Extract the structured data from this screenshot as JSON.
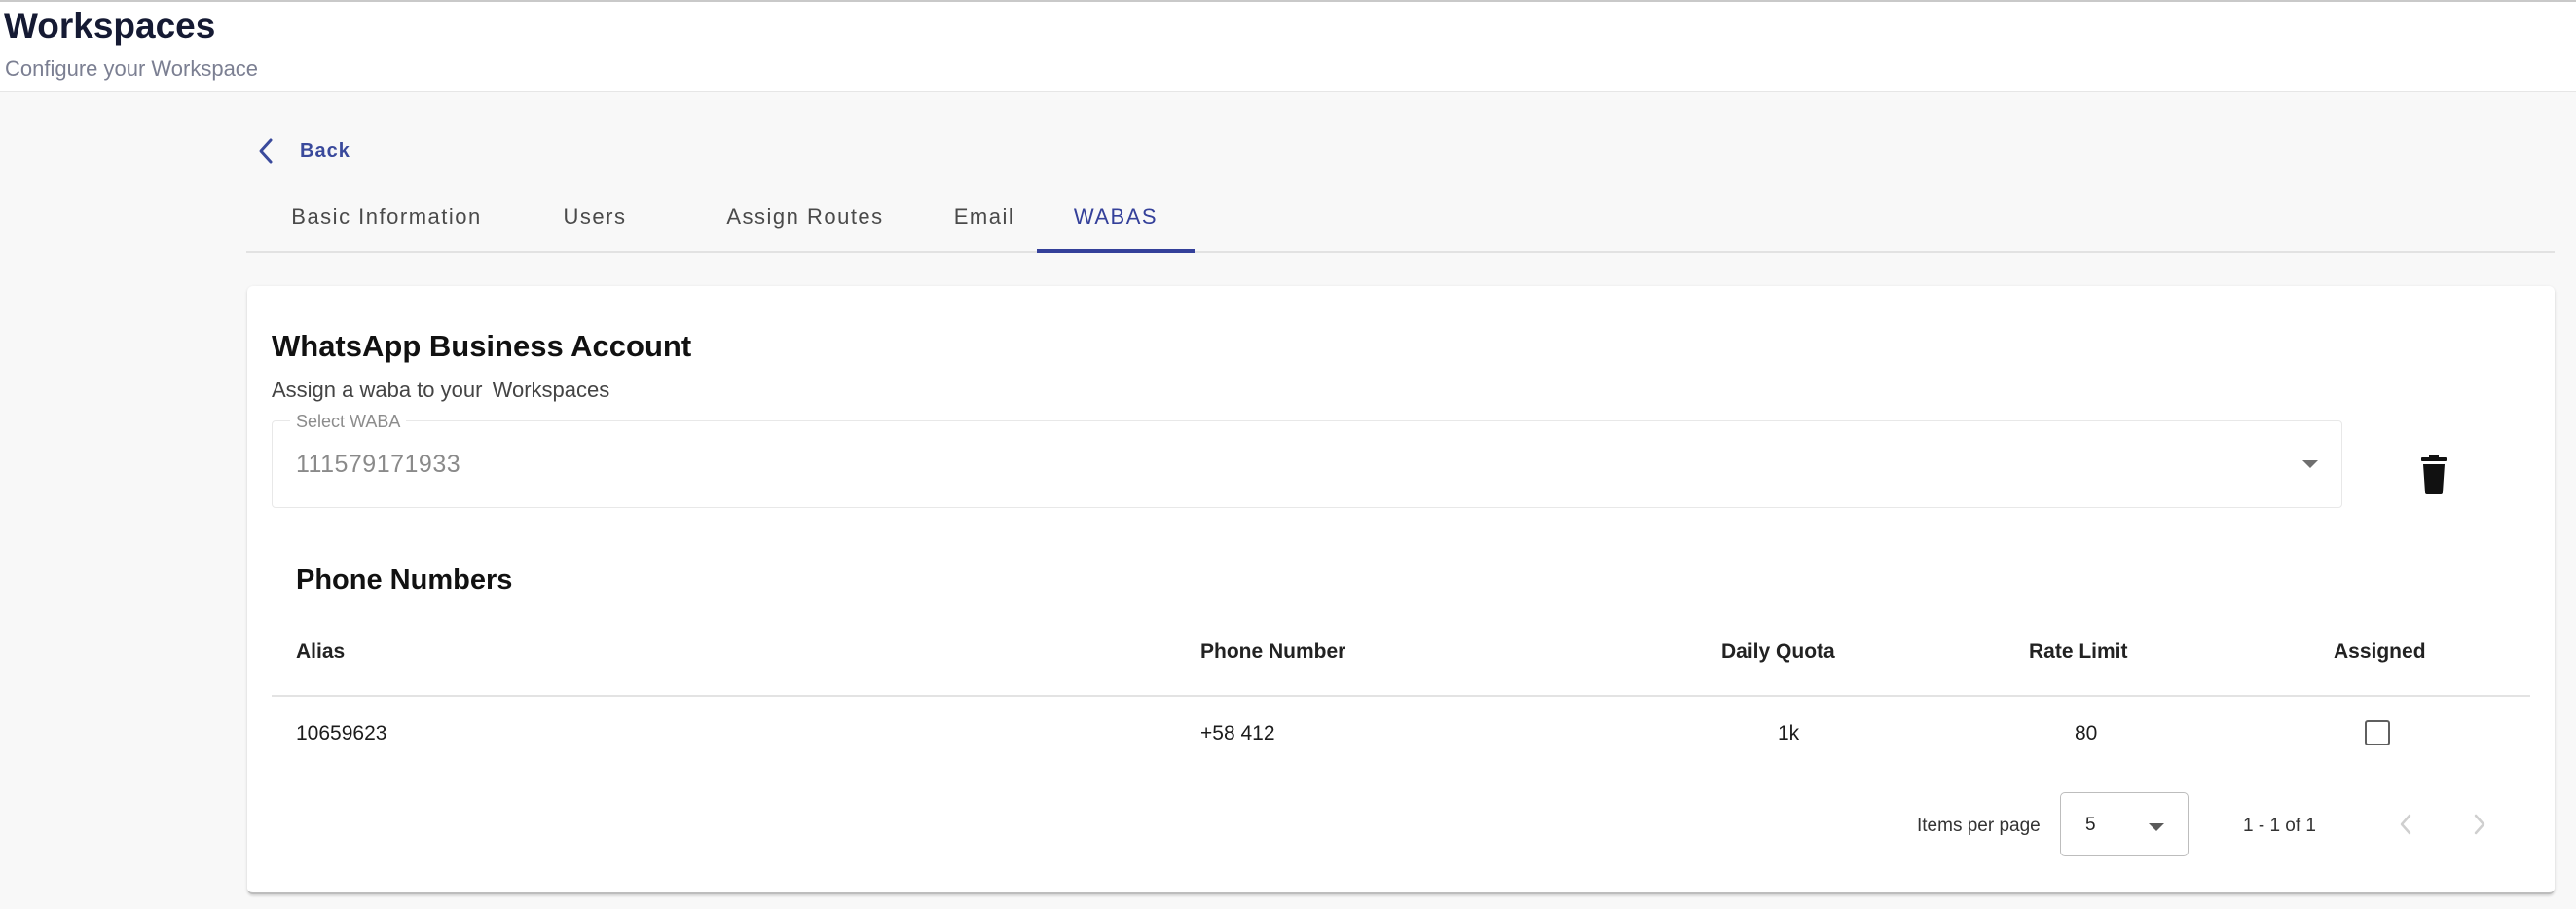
{
  "header": {
    "title": "Workspaces",
    "subtitle": "Configure your Workspace"
  },
  "nav": {
    "back_label": "Back"
  },
  "tabs": [
    {
      "label": "Basic Information",
      "active": false
    },
    {
      "label": "Users",
      "active": false
    },
    {
      "label": "Assign Routes",
      "active": false
    },
    {
      "label": "Email",
      "active": false
    },
    {
      "label": "WABAS",
      "active": true
    }
  ],
  "card": {
    "title": "WhatsApp Business Account",
    "subtitle_prefix": "Assign a waba to your",
    "subtitle_entity": "Workspaces",
    "select": {
      "label": "Select WABA",
      "value": "111579171933"
    },
    "delete_icon": "trash-icon"
  },
  "phone_numbers": {
    "title": "Phone Numbers",
    "columns": [
      "Alias",
      "Phone Number",
      "Daily Quota",
      "Rate Limit",
      "Assigned"
    ],
    "rows": [
      {
        "alias": "10659623",
        "phone": "+58 412",
        "daily_quota": "1k",
        "rate_limit": "80",
        "assigned": false
      }
    ]
  },
  "paginator": {
    "items_per_page_label": "Items per page",
    "items_per_page_value": "5",
    "range_label": "1 - 1 of 1"
  },
  "colors": {
    "accent": "#34409a",
    "title": "#151a33",
    "background": "#f8f8f8"
  }
}
